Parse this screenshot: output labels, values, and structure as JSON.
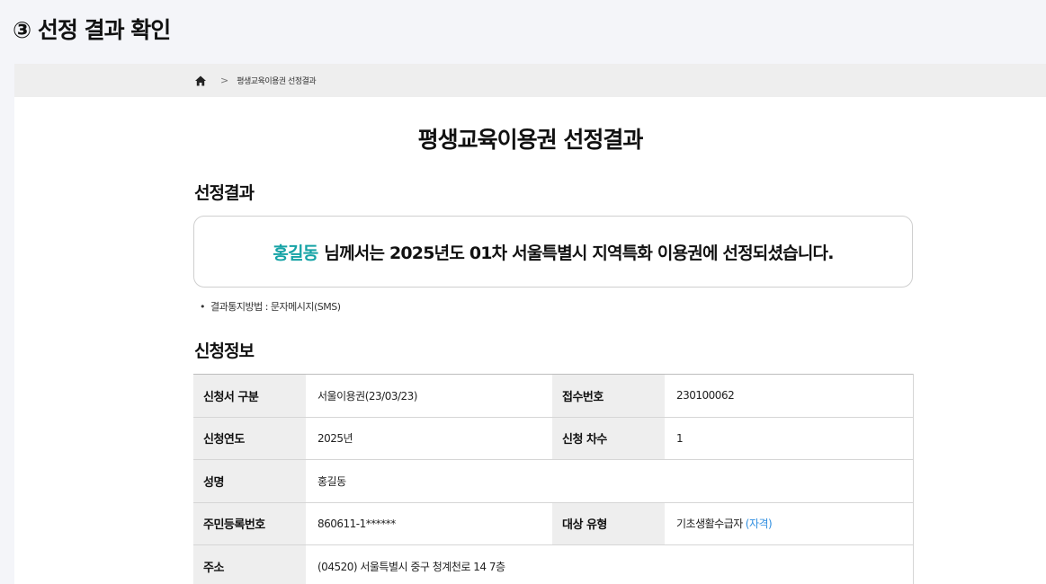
{
  "step_heading": "③ 선정 결과 확인",
  "breadcrumb": {
    "current": "평생교육이용권 선정결과",
    "separator": ">"
  },
  "page_title": "평생교육이용권 선정결과",
  "result_section": {
    "heading": "선정결과",
    "name": "홍길동",
    "message": "님께서는 2025년도 01차 서울특별시 지역특화 이용권에 선정되셨습니다.",
    "notice_bullet": "•",
    "notice": "결과통지방법 : 문자메시지(SMS)"
  },
  "info_section": {
    "heading": "신청정보",
    "rows": [
      {
        "label1": "신청서 구분",
        "value1": "서울이용권(23/03/23)",
        "label2": "접수번호",
        "value2": "230100062"
      },
      {
        "label1": "신청연도",
        "value1": "2025년",
        "label2": "신청 차수",
        "value2": "1"
      },
      {
        "label1": "성명",
        "value1": "홍길동"
      },
      {
        "label1": "주민등록번호",
        "value1": "860611-1******",
        "label2": "대상 유형",
        "value2": "기초생활수급자",
        "value2_link": "(자격)"
      },
      {
        "label1": "주소",
        "value1": "(04520) 서울특별시 중구 청계천로 14 7층"
      }
    ]
  },
  "colors": {
    "accent_teal": "#16a3a6",
    "link_blue": "#2f8ee0",
    "header_gray": "#eeeeee"
  }
}
